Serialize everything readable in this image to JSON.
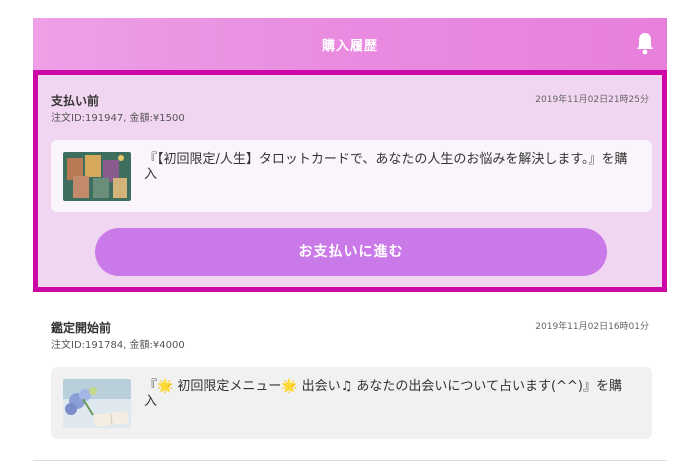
{
  "header": {
    "title": "購入履歴",
    "bell_icon": "bell-icon"
  },
  "orders": [
    {
      "status": "支払い前",
      "meta": "注文ID:191947, 金額:¥1500",
      "date": "2019年11月02日21時25分",
      "item_text": "『【初回限定/人生】タロットカードで、あなたの人生のお悩みを解決します。』を購入",
      "thumb_icon": "tarot-cards-thumbnail",
      "action_label": "お支払いに進む"
    },
    {
      "status": "鑑定開始前",
      "meta": "注文ID:191784, 金額:¥4000",
      "date": "2019年11月02日16時01分",
      "item_text": "『🌟 初回限定メニュー🌟 出会い♫ あなたの出会いについて占います(^^)』を購入",
      "thumb_icon": "flowers-book-thumbnail"
    }
  ],
  "colors": {
    "header_gradient_start": "#eea0e6",
    "header_gradient_end": "#e780db",
    "highlight_border": "#cc09a6",
    "highlight_bg": "#f1d6f2",
    "pay_button": "#c97ae8"
  }
}
